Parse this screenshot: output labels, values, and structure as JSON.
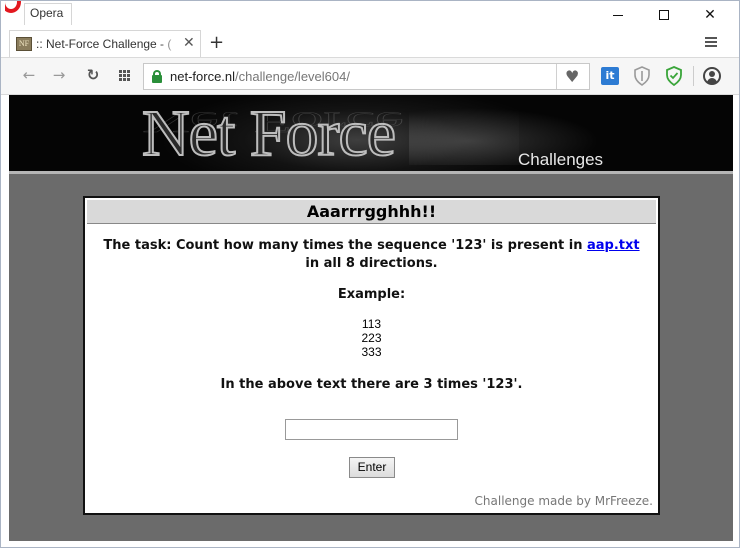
{
  "browser": {
    "app_name": "Opera",
    "tab": {
      "favicon_text": "NF",
      "title": ":: Net-Force Challenge - ("
    },
    "address": {
      "domain": "net-force.nl",
      "path": "/challenge/level604/"
    },
    "extension_it_label": "it"
  },
  "page": {
    "banner": {
      "title": "Net Force",
      "subtitle": "Challenges"
    },
    "panel": {
      "heading": "Aaarrrgghhh!!",
      "task_before": "The task: Count how many times the sequence '123' is present in ",
      "task_link": "aap.txt",
      "task_after": " in all 8 directions.",
      "example_label": "Example:",
      "example_rows": [
        "113",
        "223",
        "333"
      ],
      "example_note": "In the above text there are 3 times '123'.",
      "answer_value": "",
      "submit_label": "Enter",
      "credit": "Challenge made by MrFreeze."
    }
  },
  "colors": {
    "page_background": "#6b6b6b",
    "link": "#0000ee",
    "secure_lock": "#2a8f3a",
    "opera_red": "#e3181f"
  }
}
